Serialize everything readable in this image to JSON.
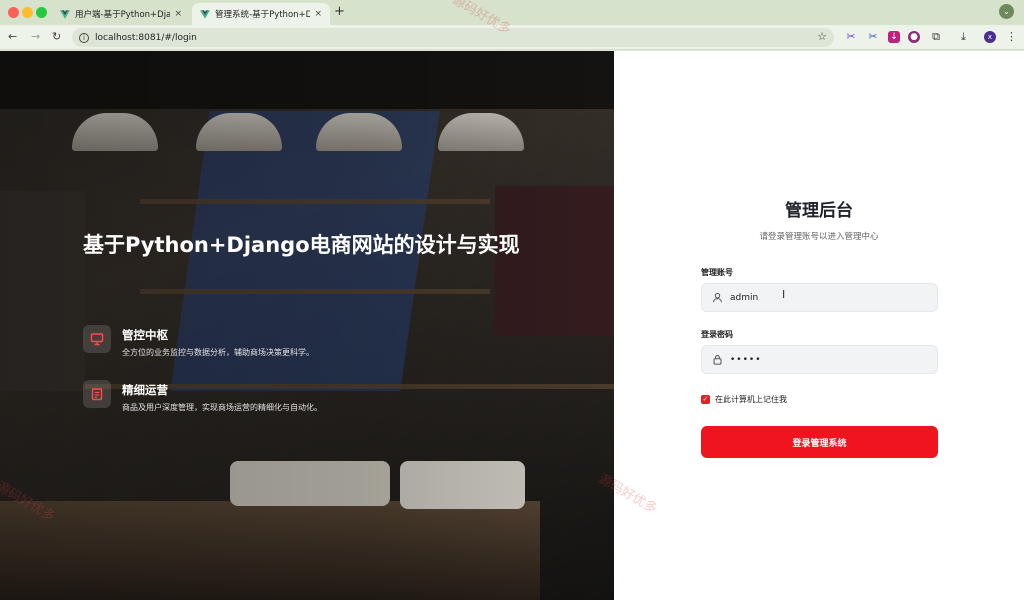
{
  "browser": {
    "tabs": [
      {
        "label": "用户端-基于Python+Django电",
        "active": false
      },
      {
        "label": "管理系统-基于Python+Django电",
        "active": true
      }
    ],
    "new_tab_glyph": "+",
    "close_glyph": "×",
    "url": "localhost:8081/#/login",
    "profile_initial": "x"
  },
  "hero": {
    "title": "基于Python+Django电商网站的设计与实现",
    "features": [
      {
        "title": "管控中枢",
        "desc": "全方位的业务监控与数据分析，辅助商场决策更科学。",
        "icon": "monitor-icon"
      },
      {
        "title": "精细运营",
        "desc": "商品及用户深度管理，实现商场运营的精细化与自动化。",
        "icon": "clipboard-icon"
      }
    ]
  },
  "login": {
    "title": "管理后台",
    "subtitle": "请登录管理账号以进入管理中心",
    "username_label": "管理账号",
    "username_value": "admin",
    "password_label": "登录密码",
    "password_mask": "•••••",
    "remember_label": "在此计算机上记住我",
    "remember_checked": true,
    "submit_label": "登录管理系统"
  },
  "watermark": "源码好优多",
  "colors": {
    "primary": "#f0141f",
    "accent_checkbox": "#e02424"
  }
}
